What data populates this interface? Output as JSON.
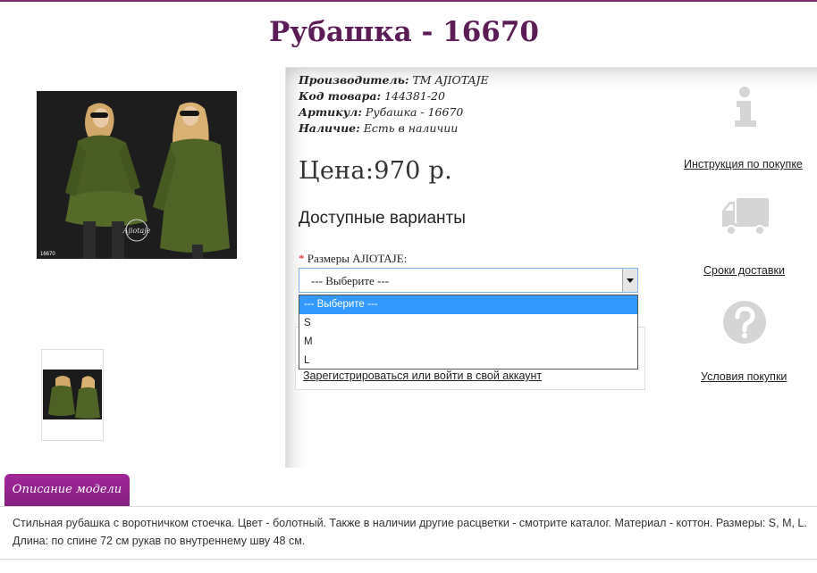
{
  "product": {
    "title": "Рубашка - 16670",
    "photo_code": "16670",
    "watermark": "Ajiotaje"
  },
  "details": {
    "manufacturer_label": "Производитель:",
    "manufacturer_value": "ТМ AJIOTAJE",
    "code_label": "Код товара:",
    "code_value": "144381-20",
    "article_label": "Артикул:",
    "article_value": "Рубашка - 16670",
    "stock_label": "Наличие:",
    "stock_value": "Есть в наличии"
  },
  "price": {
    "label": "Цена:",
    "value": "970 р."
  },
  "variants": {
    "heading": "Доступные варианты",
    "required_mark": "*",
    "size_label": "Размеры AJIOTAJE:",
    "selected": "--- Выберите ---",
    "options": [
      "--- Выберите ---",
      "S",
      "M",
      "L"
    ]
  },
  "login_link": "Зарегистрироваться или войти в свой аккаунт",
  "sidebar": {
    "instructions": "Инструкция по покупке",
    "delivery": "Сроки доставки",
    "conditions": "Условия покупки"
  },
  "tab": {
    "description_label": "Описание модели"
  },
  "description": "Стильная рубашка с воротничком стоечка. Цвет - болотный. Также в наличии другие расцветки - смотрите каталог. Материал - коттон. Размеры: S, M, L. Длина: по спине 72 см рукав по внутреннему шву 48 см.",
  "colors": {
    "accent": "#86207f",
    "title": "#5c1d57",
    "select_highlight": "#3399ff",
    "icon_gray": "#d5d5d5"
  }
}
